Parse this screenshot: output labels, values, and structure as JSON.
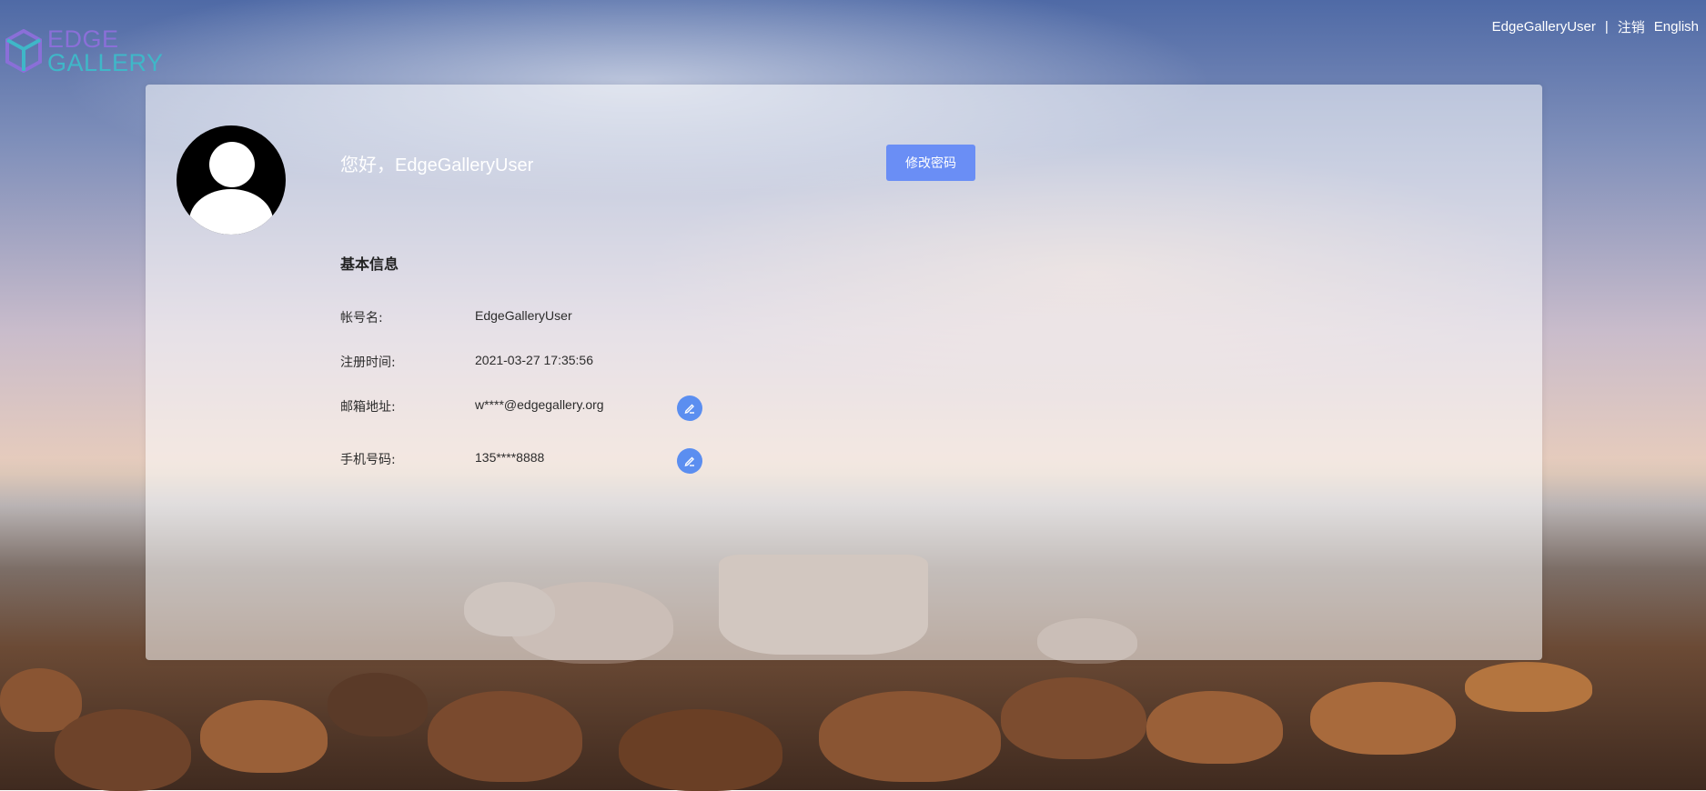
{
  "brand": {
    "line1": "EDGE",
    "line2": "GALLERY"
  },
  "topnav": {
    "user": "EdgeGalleryUser",
    "separator": "|",
    "logout": "注销",
    "language": "English"
  },
  "profile": {
    "greeting": "您好，EdgeGalleryUser",
    "change_password": "修改密码",
    "section_title": "基本信息",
    "fields": [
      {
        "label": "帐号名:",
        "value": "EdgeGalleryUser"
      },
      {
        "label": "注册时间:",
        "value": "2021-03-27 17:35:56"
      },
      {
        "label": "邮箱地址:",
        "value": "w****@edgegallery.org"
      },
      {
        "label": "手机号码:",
        "value": "135****8888"
      }
    ]
  },
  "icons": {
    "avatar": "user-avatar-icon",
    "edit": "pencil-icon",
    "logo": "cube-icon"
  },
  "colors": {
    "primary": "#6a8ef5",
    "edit_button": "#5b8ef0",
    "logo_edge": "#8a6fd8",
    "logo_gallery": "#3fb7c8"
  }
}
